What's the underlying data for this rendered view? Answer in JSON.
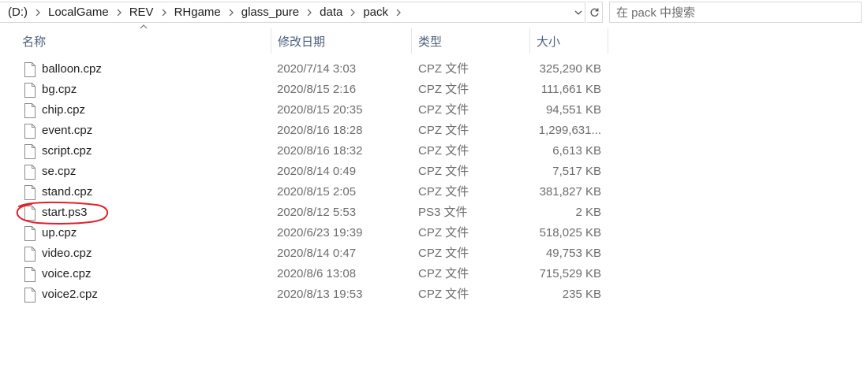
{
  "address_bar": {
    "crumbs": [
      "(D:)",
      "LocalGame",
      "REV",
      "RHgame",
      "glass_pure",
      "data",
      "pack"
    ]
  },
  "search": {
    "placeholder": "在 pack 中搜索"
  },
  "columns": {
    "name": "名称",
    "date": "修改日期",
    "type": "类型",
    "size": "大小"
  },
  "files": [
    {
      "name": "balloon.cpz",
      "date": "2020/7/14 3:03",
      "type": "CPZ 文件",
      "size": "325,290 KB"
    },
    {
      "name": "bg.cpz",
      "date": "2020/8/15 2:16",
      "type": "CPZ 文件",
      "size": "111,661 KB"
    },
    {
      "name": "chip.cpz",
      "date": "2020/8/15 20:35",
      "type": "CPZ 文件",
      "size": "94,551 KB"
    },
    {
      "name": "event.cpz",
      "date": "2020/8/16 18:28",
      "type": "CPZ 文件",
      "size": "1,299,631..."
    },
    {
      "name": "script.cpz",
      "date": "2020/8/16 18:32",
      "type": "CPZ 文件",
      "size": "6,613 KB"
    },
    {
      "name": "se.cpz",
      "date": "2020/8/14 0:49",
      "type": "CPZ 文件",
      "size": "7,517 KB"
    },
    {
      "name": "stand.cpz",
      "date": "2020/8/15 2:05",
      "type": "CPZ 文件",
      "size": "381,827 KB"
    },
    {
      "name": "start.ps3",
      "date": "2020/8/12 5:53",
      "type": "PS3 文件",
      "size": "2 KB"
    },
    {
      "name": "up.cpz",
      "date": "2020/6/23 19:39",
      "type": "CPZ 文件",
      "size": "518,025 KB"
    },
    {
      "name": "video.cpz",
      "date": "2020/8/14 0:47",
      "type": "CPZ 文件",
      "size": "49,753 KB"
    },
    {
      "name": "voice.cpz",
      "date": "2020/8/6 13:08",
      "type": "CPZ 文件",
      "size": "715,529 KB"
    },
    {
      "name": "voice2.cpz",
      "date": "2020/8/13 19:53",
      "type": "CPZ 文件",
      "size": "235 KB"
    }
  ],
  "colors": {
    "annotation": "#e0202a",
    "header_text": "#4c607a",
    "meta_text": "#6d6d6d"
  },
  "icons": [
    "chevron-right-icon",
    "chevron-down-icon",
    "refresh-icon",
    "sort-up-icon",
    "file-icon"
  ]
}
